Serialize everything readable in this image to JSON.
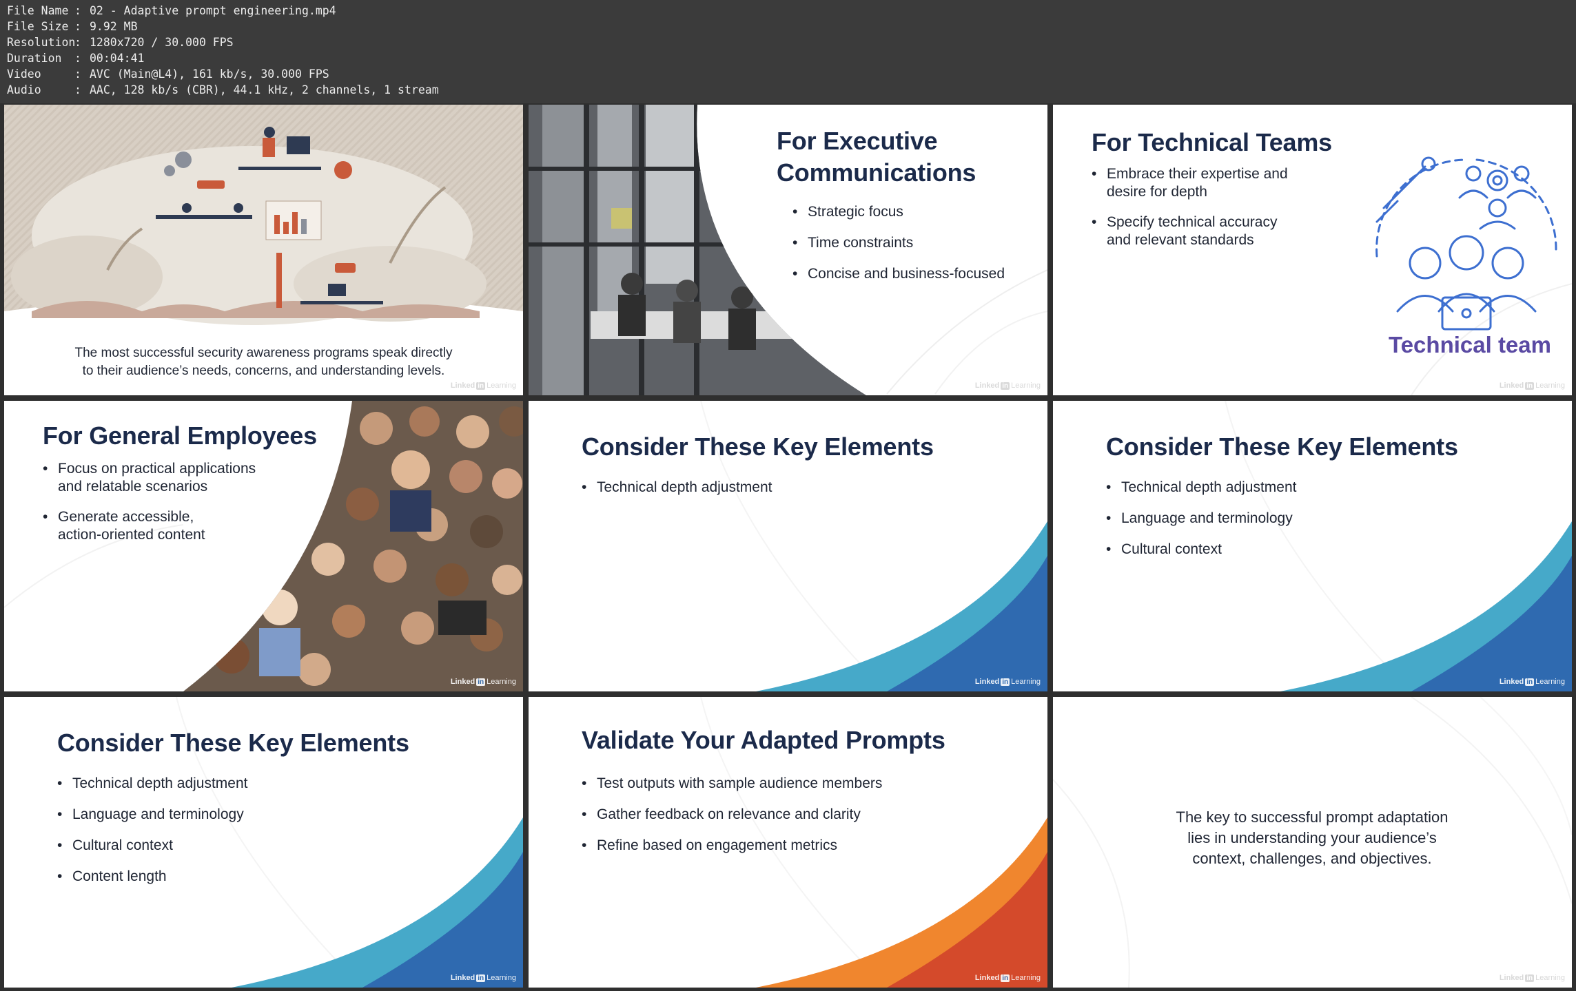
{
  "file_info": [
    {
      "key": "File Name",
      "value": "02 - Adaptive prompt engineering.mp4"
    },
    {
      "key": "File Size",
      "value": "9.92 MB"
    },
    {
      "key": "Resolution",
      "value": "1280x720 / 30.000 FPS"
    },
    {
      "key": "Duration",
      "value": "00:04:41"
    },
    {
      "key": "Video",
      "value": "AVC (Main@L4), 161 kb/s, 30.000 FPS"
    },
    {
      "key": "Audio",
      "value": "AAC, 128 kb/s (CBR), 44.1 kHz, 2 channels, 1 stream"
    }
  ],
  "separator": ":",
  "brand": {
    "left": "Linked",
    "mark": "in",
    "right": "Learning"
  },
  "slides": {
    "s1": {
      "caption_1": "The most successful security awareness programs speak directly",
      "caption_2": "to their audience’s needs, concerns, and understanding levels."
    },
    "s2": {
      "title_1": "For Executive",
      "title_2": "Communications",
      "bullets": [
        "Strategic focus",
        "Time constraints",
        "Concise and business-focused"
      ]
    },
    "s3": {
      "title": "For Technical Teams",
      "b1_l1": "Embrace their expertise and",
      "b1_l2": "desire for depth",
      "b2_l1": "Specify technical accuracy",
      "b2_l2": "and relevant standards",
      "illustration_label": "Technical team"
    },
    "s4": {
      "title": "For General Employees",
      "b1_l1": "Focus on practical applications",
      "b1_l2": "and relatable scenarios",
      "b2_l1": "Generate accessible,",
      "b2_l2": "action-oriented content"
    },
    "s5": {
      "title": "Consider These Key Elements",
      "bullets": [
        "Technical depth adjustment"
      ]
    },
    "s6": {
      "title": "Consider These Key Elements",
      "bullets": [
        "Technical depth adjustment",
        "Language and terminology",
        "Cultural context"
      ]
    },
    "s7": {
      "title": "Consider These Key Elements",
      "bullets": [
        "Technical depth adjustment",
        "Language and terminology",
        "Cultural context",
        "Content length"
      ]
    },
    "s8": {
      "title": "Validate Your Adapted Prompts",
      "bullets": [
        "Test outputs with sample audience members",
        "Gather feedback on relevance and clarity",
        "Refine based on engagement metrics"
      ]
    },
    "s9": {
      "quote_1": "The key to successful prompt adaptation",
      "quote_2": "lies in understanding your audience’s",
      "quote_3": "context, challenges, and objectives."
    }
  },
  "icons": [
    "gear-icon",
    "wrench-icon",
    "users-icon",
    "laptop-icon"
  ],
  "colors": {
    "title_navy": "#1b2a4a",
    "blue": "#2f6ab0",
    "teal": "#46a9c9",
    "orange": "#f0862e",
    "red_orange": "#d44a2b",
    "purple": "#5a4aa3"
  }
}
